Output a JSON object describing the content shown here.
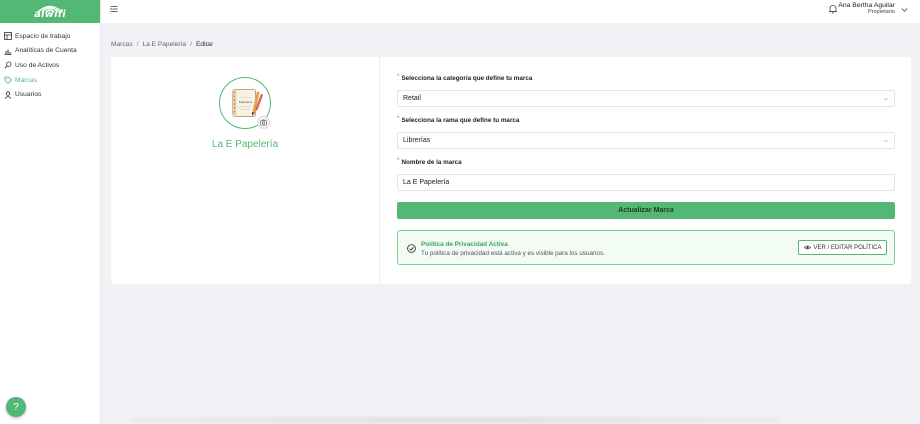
{
  "brand": {
    "logo_text": "aiwifi",
    "color": "#52b874"
  },
  "sidebar": {
    "items": [
      {
        "label": "Espacio de trabajo",
        "icon": "table-icon",
        "active": false
      },
      {
        "label": "Analíticas de Cuenta",
        "icon": "bar-chart-icon",
        "active": false
      },
      {
        "label": "Uso de Activos",
        "icon": "search-icon",
        "active": false
      },
      {
        "label": "Marcas",
        "icon": "tag-icon",
        "active": true
      },
      {
        "label": "Usuarios",
        "icon": "user-icon",
        "active": false
      }
    ]
  },
  "topbar": {
    "user_name": "Ana Bertha Aguilar",
    "user_role": "Propietario"
  },
  "breadcrumb": {
    "items": [
      "Marcas",
      "La E Papelería",
      "Editar"
    ],
    "separator": "/"
  },
  "brand_profile": {
    "name": "La E Papelería",
    "avatar_caption": "Papelería"
  },
  "form": {
    "category": {
      "label": "Selecciona la categoría que define tu marca",
      "value": "Retail"
    },
    "branch": {
      "label": "Selecciona la rama que define tu marca",
      "value": "Librerías"
    },
    "brand_name": {
      "label": "Nombre de la marca",
      "value": "La E Papelería"
    },
    "required_mark": "*",
    "submit_label": "Actualizar Marca"
  },
  "privacy": {
    "title": "Política de Privacidad Activa",
    "description": "Tu política de privacidad está activa y es visible para los usuarios.",
    "button_label": "VER / EDITAR POLÍTICA"
  },
  "help": {
    "label": "?"
  }
}
